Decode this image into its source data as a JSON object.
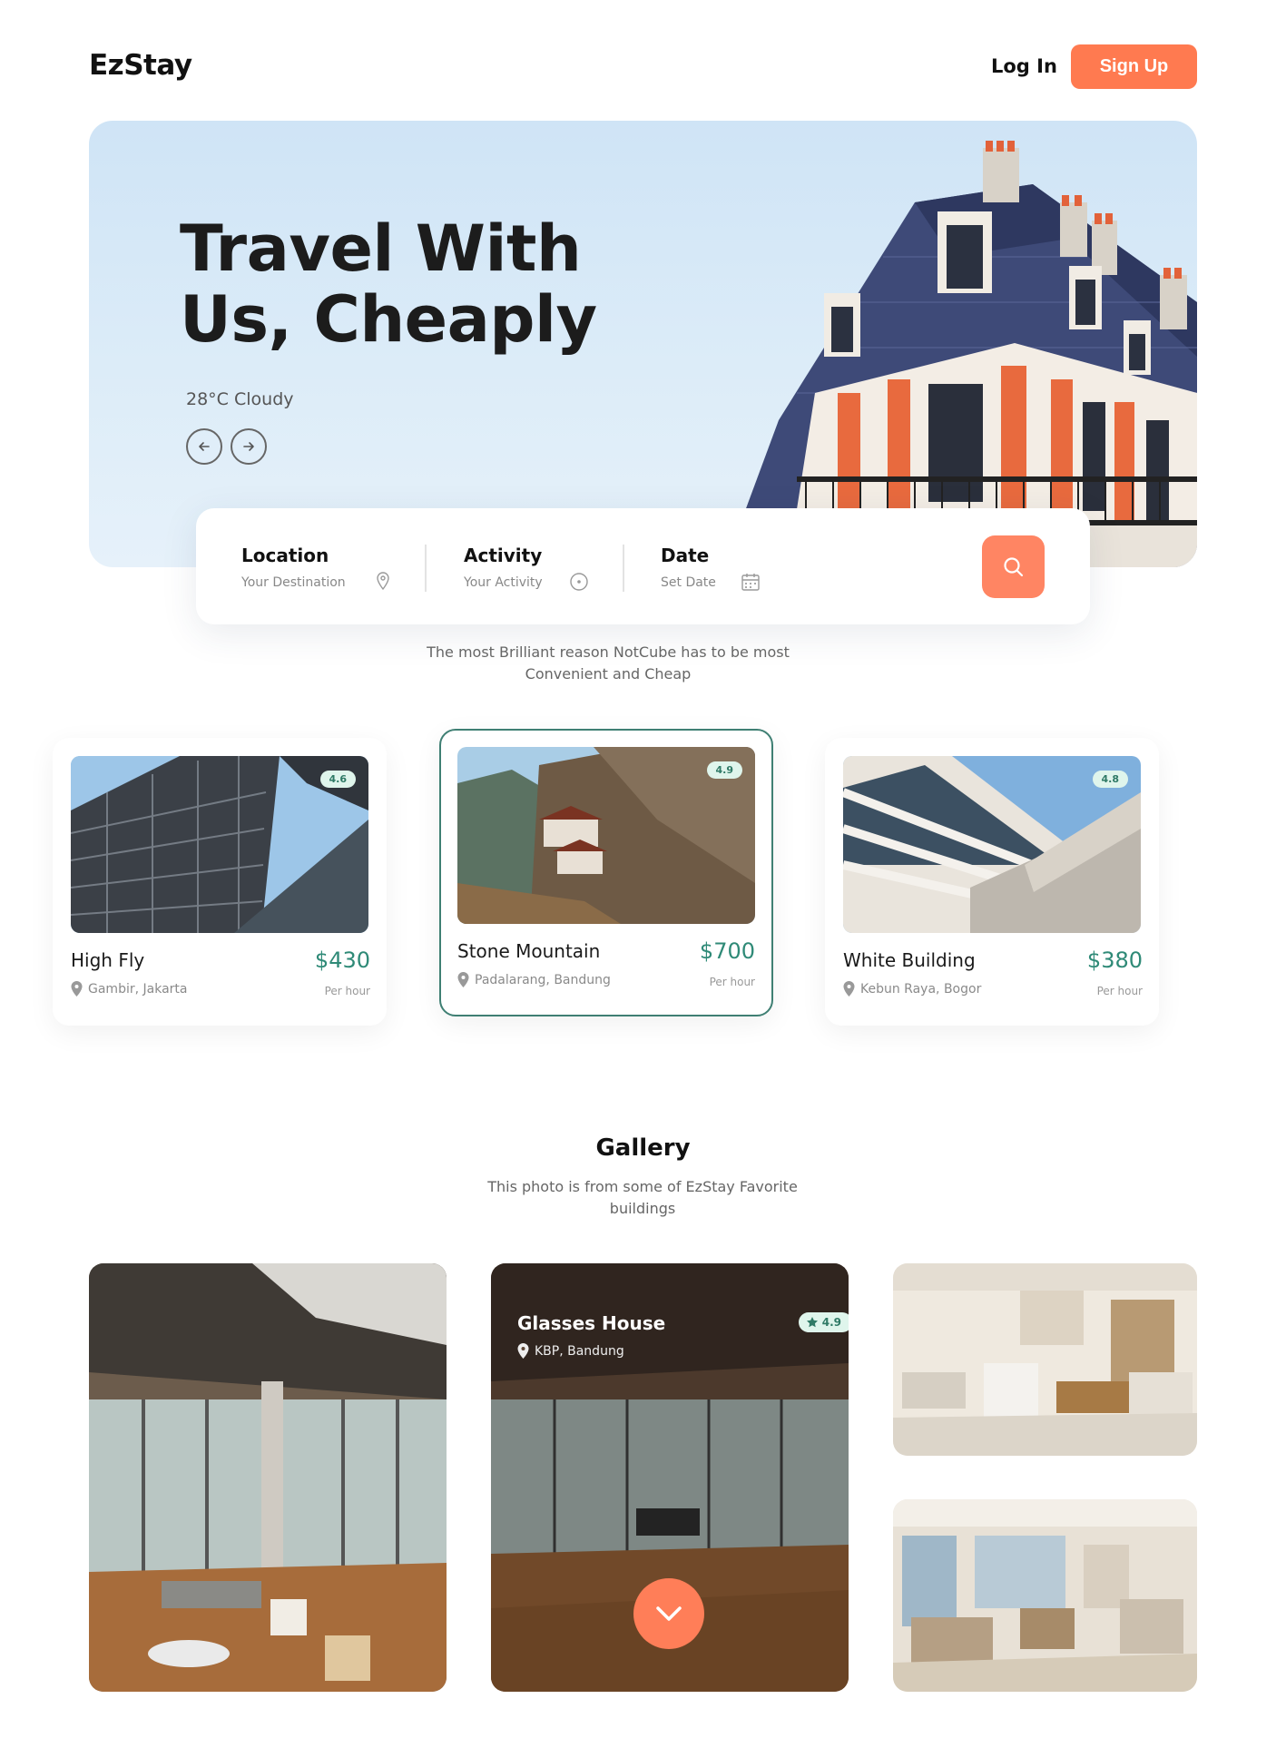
{
  "header": {
    "logo": "EzStay",
    "login_label": "Log In",
    "signup_label": "Sign Up"
  },
  "hero": {
    "title": "Travel With Us, Cheaply",
    "weather": "28°C Cloudy",
    "prev_icon": "arrow-left-icon",
    "next_icon": "arrow-right-icon"
  },
  "search": {
    "fields": [
      {
        "label": "Location",
        "hint": "Your Destination",
        "icon": "map-pin-icon"
      },
      {
        "label": "Activity",
        "hint": "Your Activity",
        "icon": "compass-icon"
      },
      {
        "label": "Date",
        "hint": "Set Date",
        "icon": "calendar-icon"
      }
    ],
    "button_icon": "search-icon"
  },
  "reasons": {
    "subtitle": "The most Brilliant reason NotCube has to be most Convenient and Cheap"
  },
  "places": [
    {
      "name": "High Fly",
      "price": "$430",
      "location": "Gambir, Jakarta",
      "per": "Per hour",
      "rating": "4.6"
    },
    {
      "name": "Stone Mountain",
      "price": "$700",
      "location": "Padalarang, Bandung",
      "per": "Per hour",
      "rating": "4.9"
    },
    {
      "name": "White Building",
      "price": "$380",
      "location": "Kebun Raya, Bogor",
      "per": "Per hour",
      "rating": "4.8"
    }
  ],
  "gallery": {
    "title": "Gallery",
    "subtitle": "This photo is from some of EzStay Favorite buildings",
    "featured": {
      "title": "Glasses House",
      "location": "KBP, Bandung",
      "rating": "4.9"
    },
    "scroll_icon": "chevron-down-icon"
  },
  "colors": {
    "accent": "#ff7a50",
    "teal": "#2f8a77",
    "hero_bg": "#d6e9f7"
  }
}
